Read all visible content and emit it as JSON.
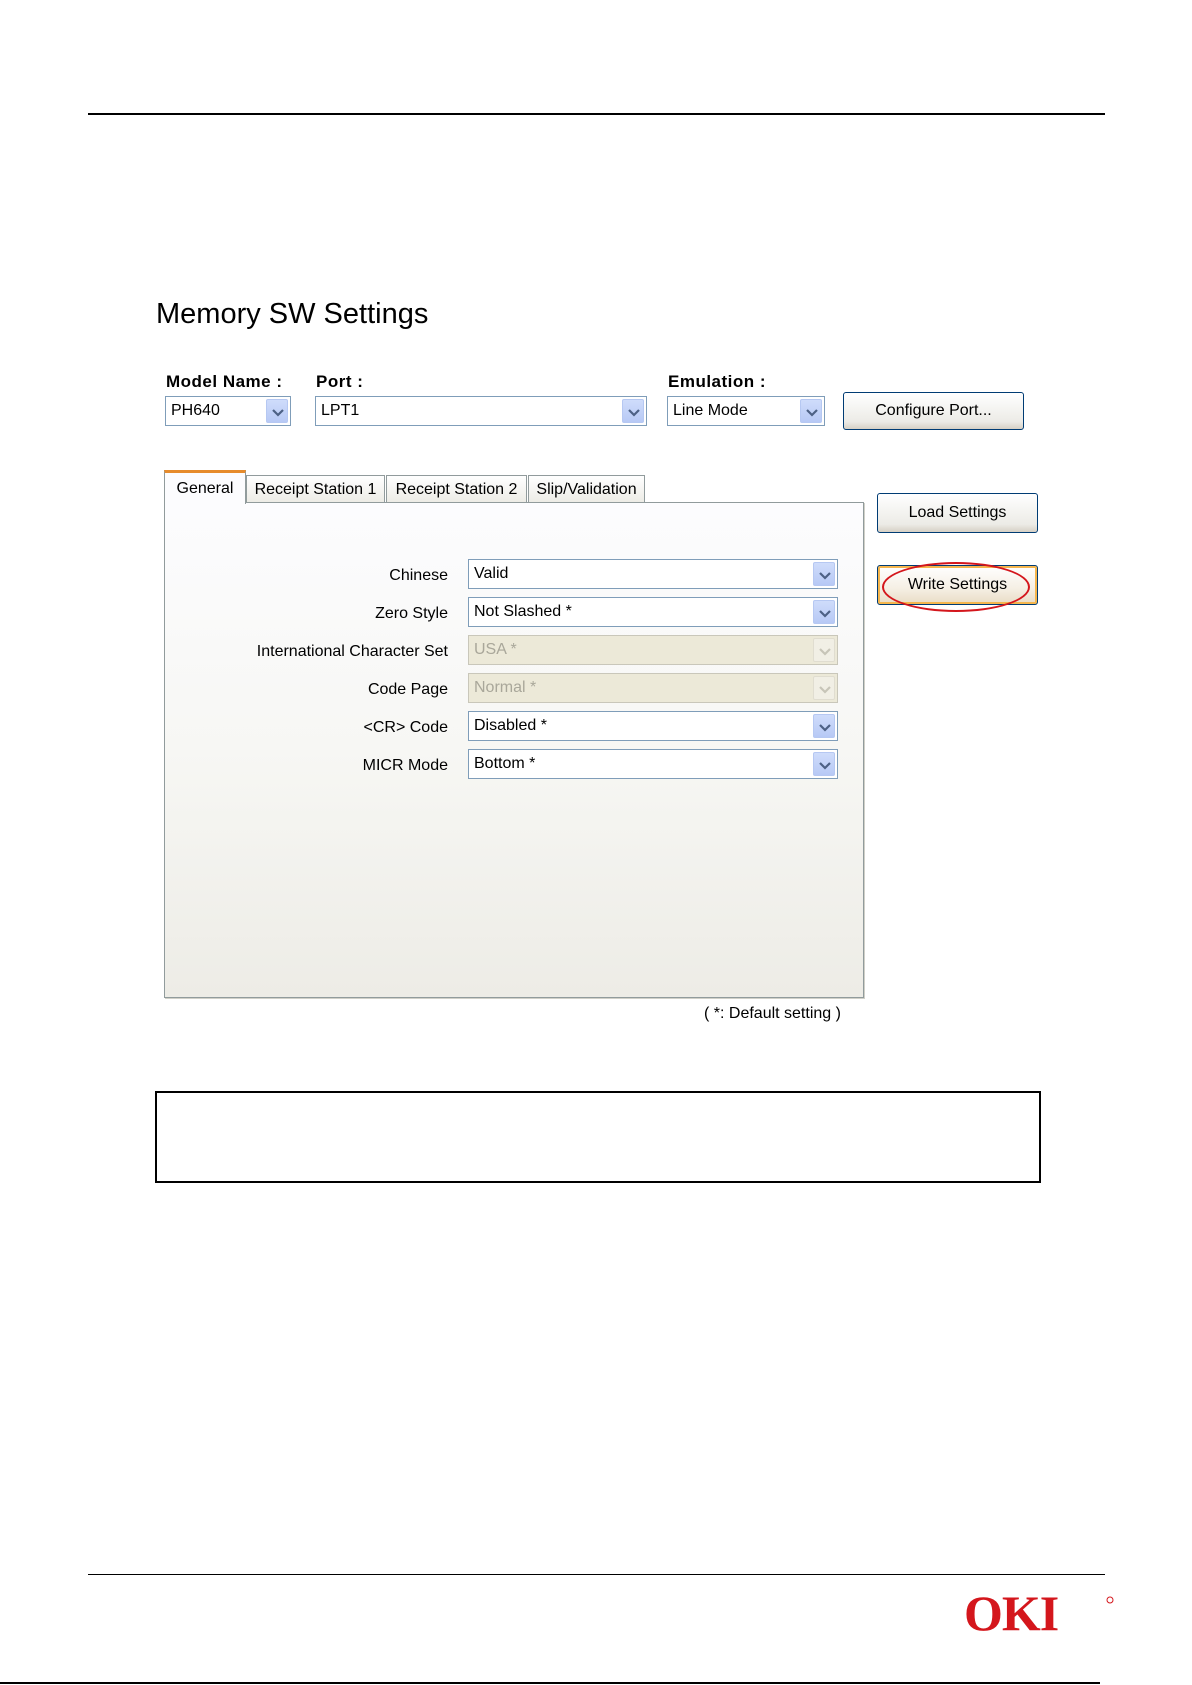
{
  "title": "Memory SW Settings",
  "top_controls": {
    "model_name_label": "Model Name :",
    "model_name_value": "PH640",
    "port_label": "Port :",
    "port_value": "LPT1",
    "emulation_label": "Emulation :",
    "emulation_value": "Line Mode",
    "configure_port_label": "Configure Port..."
  },
  "tabs": [
    {
      "label": "General",
      "active": true
    },
    {
      "label": "Receipt Station 1",
      "active": false
    },
    {
      "label": "Receipt Station 2",
      "active": false
    },
    {
      "label": "Slip/Validation",
      "active": false
    }
  ],
  "side_buttons": {
    "load_label": "Load Settings",
    "write_label": "Write Settings"
  },
  "settings": [
    {
      "label": "Chinese",
      "value": "Valid",
      "enabled": true
    },
    {
      "label": "Zero Style",
      "value": "Not Slashed *",
      "enabled": true
    },
    {
      "label": "International Character Set",
      "value": "USA *",
      "enabled": false
    },
    {
      "label": "Code Page",
      "value": "Normal *",
      "enabled": false
    },
    {
      "label": "<CR> Code",
      "value": "Disabled *",
      "enabled": true
    },
    {
      "label": "MICR Mode",
      "value": "Bottom *",
      "enabled": true
    }
  ],
  "default_note": "( *: Default setting )",
  "colors": {
    "highlight": "#d4161c",
    "logo": "#d4161c",
    "tab_accent": "#e68b2c"
  },
  "logo_text": "OKI"
}
